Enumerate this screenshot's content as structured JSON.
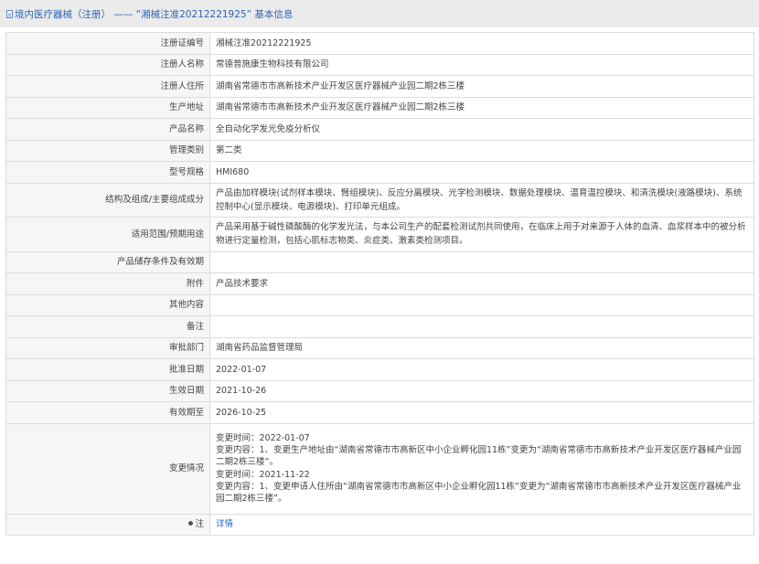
{
  "header": {
    "title": "境内医疗器械（注册） —— “湘械注准20212221925” 基本信息"
  },
  "rows": {
    "reg_no": {
      "label": "注册证编号",
      "value": "湘械注准20212221925"
    },
    "registrant": {
      "label": "注册人名称",
      "value": "常德普施康生物科技有限公司"
    },
    "registrant_addr": {
      "label": "注册人住所",
      "value": "湖南省常德市市高新技术产业开发区医疗器械产业园二期2栋三楼"
    },
    "production_addr": {
      "label": "生产地址",
      "value": "湖南省常德市市高新技术产业开发区医疗器械产业园二期2栋三楼"
    },
    "product_name": {
      "label": "产品名称",
      "value": "全自动化学发光免疫分析仪"
    },
    "category": {
      "label": "管理类别",
      "value": "第二类"
    },
    "model": {
      "label": "型号规格",
      "value": "HMI680"
    },
    "structure": {
      "label": "结构及组成/主要组成成分",
      "value": "产品由加样模块(试剂样本模块、臂组模块)、反应分离模块、光学检测模块、数据处理模块、温育温控模块、和清洗模块(液路模块)、系统控制中心(显示模块、电源模块)、打印单元组成。"
    },
    "scope": {
      "label": "适用范围/预期用途",
      "value": "产品采用基于碱性磷酸酶的化学发光法，与本公司生产的配套检测试剂共同使用，在临床上用于对来源于人体的血清、血浆样本中的被分析物进行定量检测，包括心肌标志物类、炎症类、激素类检测项目。"
    },
    "storage": {
      "label": "产品储存条件及有效期",
      "value": ""
    },
    "attachment": {
      "label": "附件",
      "value": "产品技术要求"
    },
    "other": {
      "label": "其他内容",
      "value": ""
    },
    "remark": {
      "label": "备注",
      "value": ""
    },
    "approval_dept": {
      "label": "审批部门",
      "value": "湖南省药品监督管理局"
    },
    "approval_date": {
      "label": "批准日期",
      "value": "2022-01-07"
    },
    "effective_date": {
      "label": "生效日期",
      "value": "2021-10-26"
    },
    "expiry_date": {
      "label": "有效期至",
      "value": "2026-10-25"
    },
    "changes": {
      "label": "变更情况",
      "lines": [
        "变更时间：2022-01-07",
        "变更内容：1、变更生产地址由“湖南省常德市市高新区中小企业孵化园11栋”变更为“湖南省常德市市高新技术产业开发区医疗器械产业园二期2栋三楼”。",
        "变更时间：2021-11-22",
        "变更内容：1、变更申请人住所由“湖南省常德市市高新区中小企业孵化园11栋”变更为“湖南省常德市市高新技术产业开发区医疗器械产业园二期2栋三楼”。"
      ]
    },
    "note": {
      "label": "注",
      "value": "详情"
    }
  }
}
